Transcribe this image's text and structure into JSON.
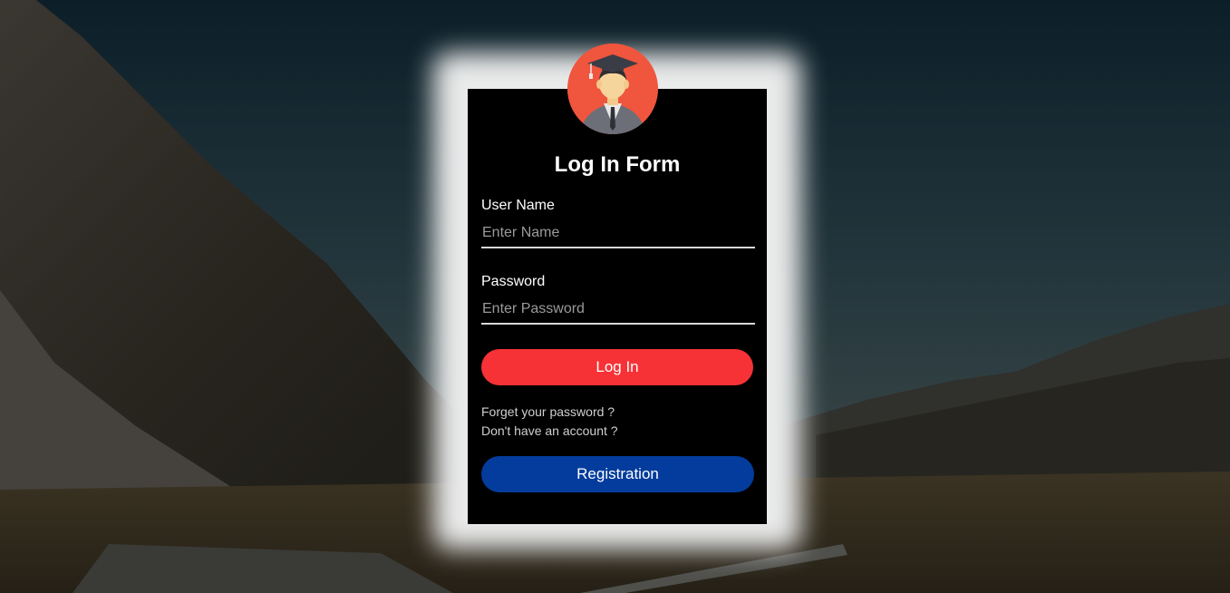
{
  "form": {
    "title": "Log In Form",
    "username_label": "User Name",
    "username_placeholder": "Enter Name",
    "password_label": "Password",
    "password_placeholder": "Enter Password",
    "login_button": "Log In",
    "forgot_link": "Forget your password ?",
    "no_account_link": "Don't have an account ?",
    "register_button": "Registration"
  },
  "icons": {
    "avatar": "graduate-avatar-icon"
  },
  "colors": {
    "card_background": "#000000",
    "login_button": "#f63237",
    "register_button": "#033c9c",
    "avatar_background": "#f0553d"
  }
}
